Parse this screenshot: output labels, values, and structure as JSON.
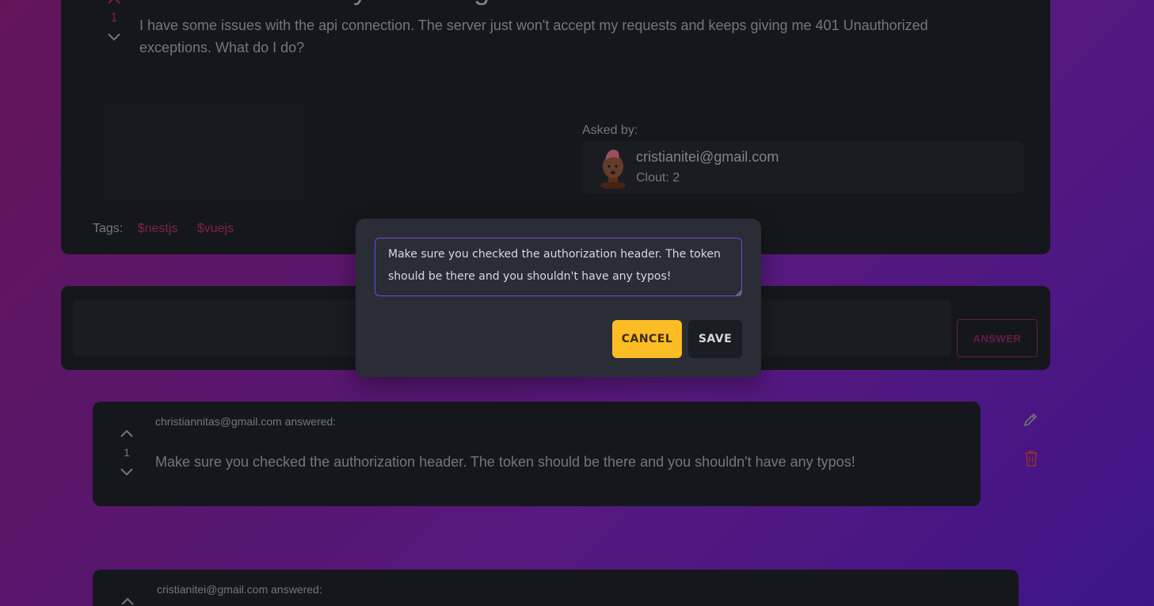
{
  "question": {
    "title": "How do I code my SD assignment?",
    "body": "I have some issues with the api connection. The server just won't accept my requests and keeps giving me 401 Unauthorized exceptions. What do I do?",
    "votes": "1",
    "asked_by_label": "Asked by:",
    "asker_email": "cristianitei@gmail.com",
    "asker_clout": "Clout: 2",
    "tags_label": "Tags:",
    "tags": [
      "$nestjs",
      "$vuejs"
    ]
  },
  "answer_form": {
    "input_value": "",
    "submit_label": "ANSWER"
  },
  "answers": [
    {
      "author_line": "christiannitas@gmail.com answered:",
      "votes": "1",
      "text": "Make sure you checked the authorization header. The token should be there and you shouldn't have any typos!"
    },
    {
      "author_line": "cristianitei@gmail.com answered:"
    }
  ],
  "edit_modal": {
    "textarea_value": "Make sure you checked the authorization header. The token should be there and you shouldn't have any typos!",
    "cancel_label": "CANCEL",
    "save_label": "SAVE"
  },
  "icons": {
    "edit": "pencil-icon",
    "delete": "trash-icon",
    "upvote": "chevron-up-icon",
    "downvote": "chevron-down-icon"
  },
  "colors": {
    "accent_purple": "#7b3fe4",
    "cancel_yellow": "#fbbd23",
    "tag_pink": "#9a2a66",
    "delete_red": "#b33a3a"
  }
}
